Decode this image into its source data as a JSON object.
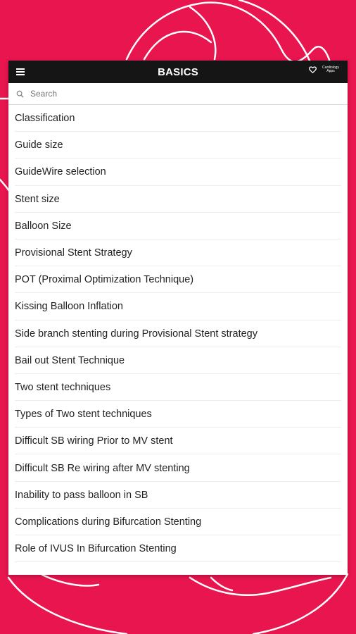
{
  "header": {
    "title": "BASICS",
    "brand_line1": "Cardiology",
    "brand_line2": "Apps"
  },
  "search": {
    "placeholder": "Search"
  },
  "icons": {
    "menu": "hamburger-menu-icon",
    "search": "search-icon",
    "brand": "heart-logo-icon"
  },
  "colors": {
    "background": "#e8154f",
    "appbar": "#151515",
    "panel": "#ffffff"
  },
  "menu": {
    "items": [
      "Classification",
      "Guide size",
      "GuideWire selection",
      "Stent size",
      "Balloon Size",
      "Provisional Stent Strategy",
      "POT (Proximal Optimization Technique)",
      "Kissing Balloon Inflation",
      "Side branch stenting during Provisional Stent strategy",
      "Bail out Stent Technique",
      "Two stent techniques",
      "Types of Two stent techniques",
      "Difficult SB wiring Prior to MV stent",
      "Difficult SB Re wiring after MV stenting",
      "Inability to pass balloon in SB",
      "Complications during Bifurcation Stenting",
      "Role of IVUS In Bifurcation Stenting"
    ]
  }
}
